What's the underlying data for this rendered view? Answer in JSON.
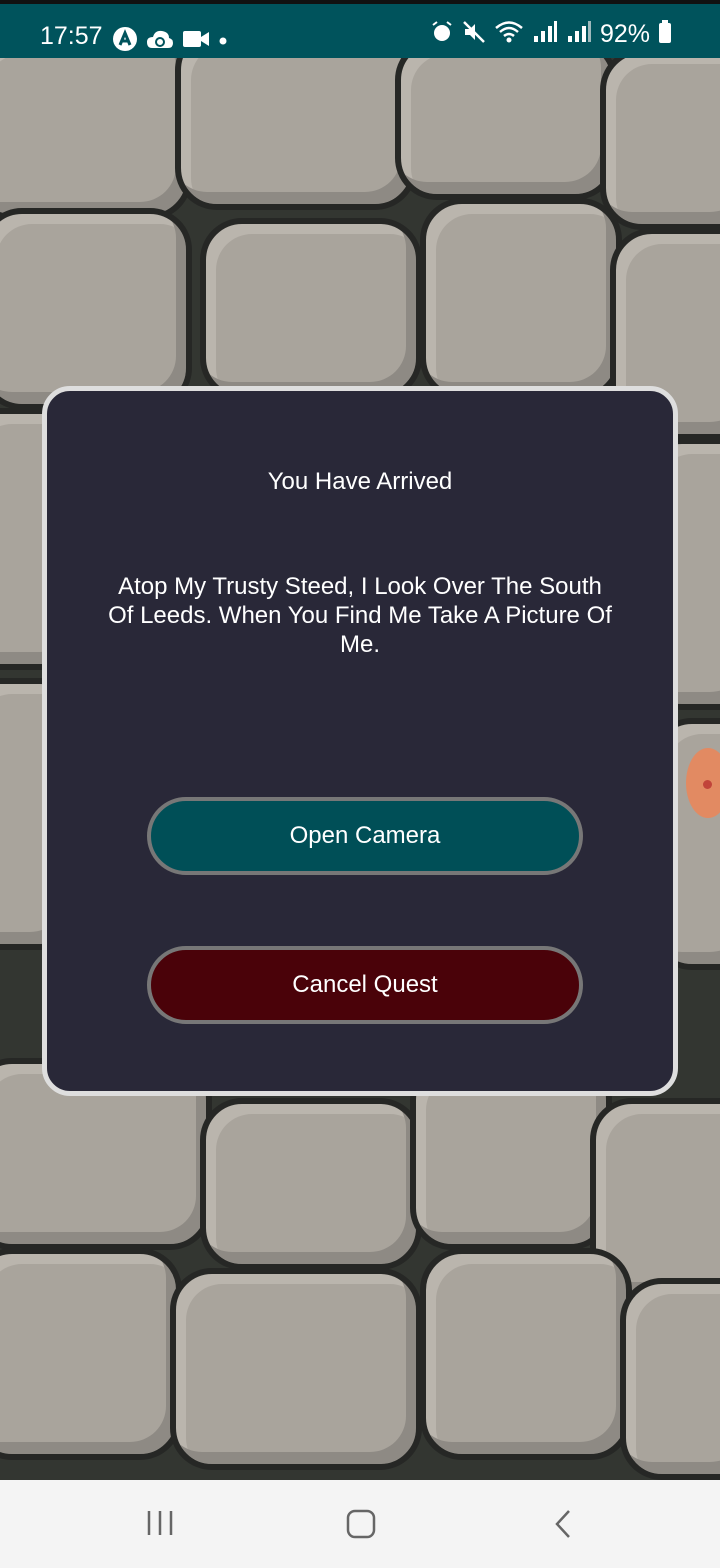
{
  "status_bar": {
    "time": "17:57",
    "battery_percent": "92%",
    "background_color": "#00535c",
    "left_icons": [
      "app-a-icon",
      "cloud-sync-icon",
      "video-camera-icon",
      "dot-icon"
    ],
    "right_icons": [
      "alarm-icon",
      "mute-icon",
      "wifi-icon",
      "signal-icon",
      "signal-icon-2",
      "battery-icon"
    ]
  },
  "dialog": {
    "title": "You Have Arrived",
    "message": "Atop My Trusty Steed, I Look Over The South Of Leeds. When You Find Me Take A Picture Of Me.",
    "open_camera_label": "Open Camera",
    "cancel_quest_label": "Cancel Quest",
    "colors": {
      "dialog_bg": "#292838",
      "open_camera_bg": "#004f57",
      "cancel_quest_bg": "#4a0209"
    }
  },
  "nav_bar": {
    "icons": [
      "recent-apps-icon",
      "home-icon",
      "back-icon"
    ]
  }
}
